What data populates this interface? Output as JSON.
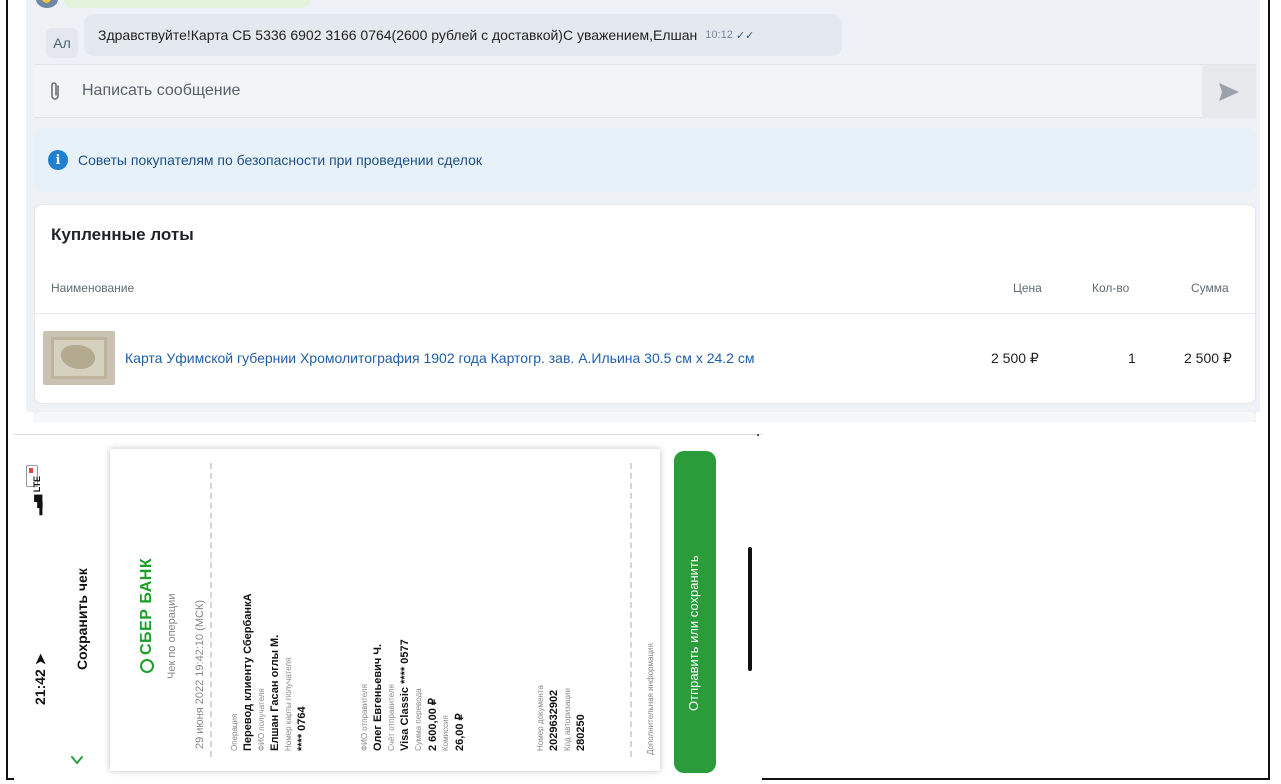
{
  "chat": {
    "avatar_initials": "Ал",
    "message_text": "Здравствуйте!Карта СБ 5336 6902 3166 0764(2600 рублей с доставкой)С уважением,Елшан",
    "message_time": "10:12",
    "message_ticks": "✓✓",
    "composer_placeholder": "Написать сообщение"
  },
  "tips": {
    "text": "Советы покупателям по безопасности при проведении сделок"
  },
  "lots": {
    "title": "Купленные лоты",
    "headers": {
      "name": "Наименование",
      "price": "Цена",
      "qty": "Кол-во",
      "sum": "Сумма"
    },
    "items": [
      {
        "name": "Карта Уфимской губернии Хромолитография 1902 года Картогр. зав. А.Ильина 30.5 см х 24.2 см",
        "price": "2 500 ₽",
        "qty": "1",
        "sum": "2 500 ₽"
      }
    ]
  },
  "receipt": {
    "status_time": "21:42",
    "network": "LTE",
    "header_title": "Сохранить чек",
    "bank_logo": "СБЕР БАНК",
    "doc_title": "Чек по операции",
    "doc_datetime": "29 июня 2022 19:42:10 (МСК)",
    "fields": {
      "op_label": "Операция",
      "op_value": "Перевод клиенту СбербанкА",
      "recipient_label": "ФИО получателя",
      "recipient_value": "Елшан Гасан оглы М.",
      "card_label": "Номер карты получателя",
      "card_value": "**** 0764",
      "sender_label": "ФИО отправителя",
      "sender_value": "Олег Евгеньевич Ч.",
      "account_label": "Счёт отправителя",
      "account_value": "Visa Classic **** 0577",
      "amount_label": "Сумма перевода",
      "amount_value": "2 600,00 ₽",
      "fee_label": "Комиссия",
      "fee_value": "26,00 ₽",
      "docnum_label": "Номер документа",
      "docnum_value": "2029632902",
      "auth_label": "Код авторизации",
      "auth_value": "280250",
      "extra_label": "Дополнительная информация"
    },
    "action_button": "Отправить или сохранить"
  },
  "colors": {
    "link": "#1f5ea8",
    "info": "#1e80ce",
    "sber_green": "#2a9c3a"
  }
}
